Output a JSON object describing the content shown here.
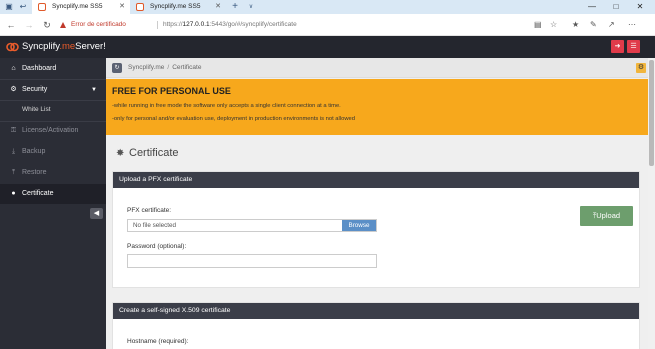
{
  "browser": {
    "tabs": [
      {
        "title": "Syncplify.me SS5",
        "active": true
      },
      {
        "title": "Syncplify.me SS5",
        "active": false
      }
    ],
    "cert_error": "Error de certificado",
    "url_prefix": "https://",
    "url_host": "127.0.0.1",
    "url_rest": ":5443/go/#/syncplify/certificate"
  },
  "app": {
    "logo_part1": "Syncplify",
    "logo_part2": ".me",
    "logo_part3": "Server!"
  },
  "sidebar": {
    "items": [
      {
        "label": "Dashboard",
        "icon": "home-icon"
      },
      {
        "label": "Security",
        "icon": "gear-icon"
      },
      {
        "label": "White List"
      },
      {
        "label": "License/Activation",
        "icon": "key-icon"
      },
      {
        "label": "Backup",
        "icon": "download-icon"
      },
      {
        "label": "Restore",
        "icon": "upload-icon"
      },
      {
        "label": "Certificate",
        "icon": "circle-icon"
      }
    ]
  },
  "breadcrumb": {
    "root": "Syncplify.me",
    "current": "Certificate"
  },
  "banner": {
    "title": "FREE FOR PERSONAL USE",
    "line1": "-while running in free mode the software only accepts a single client connection at a time.",
    "line2": "-only for personal and/or evaluation use, deployment in production environments is not allowed"
  },
  "page": {
    "title": "Certificate"
  },
  "upload_card": {
    "header": "Upload a PFX certificate",
    "pfx_label": "PFX certificate:",
    "file_placeholder": "No file selected",
    "browse_label": "Browse",
    "password_label": "Password (optional):",
    "password_value": "",
    "upload_label": "Upload"
  },
  "selfsigned_card": {
    "header": "Create a self-signed X.509 certificate",
    "hostname_label": "Hostname (required):"
  },
  "colors": {
    "banner": "#f7a81c",
    "header": "#24262e",
    "sidebar": "#2b2d36",
    "accent_red": "#e03b4a",
    "upload_green": "#6d9e6d",
    "browse_blue": "#5b8fc7"
  }
}
